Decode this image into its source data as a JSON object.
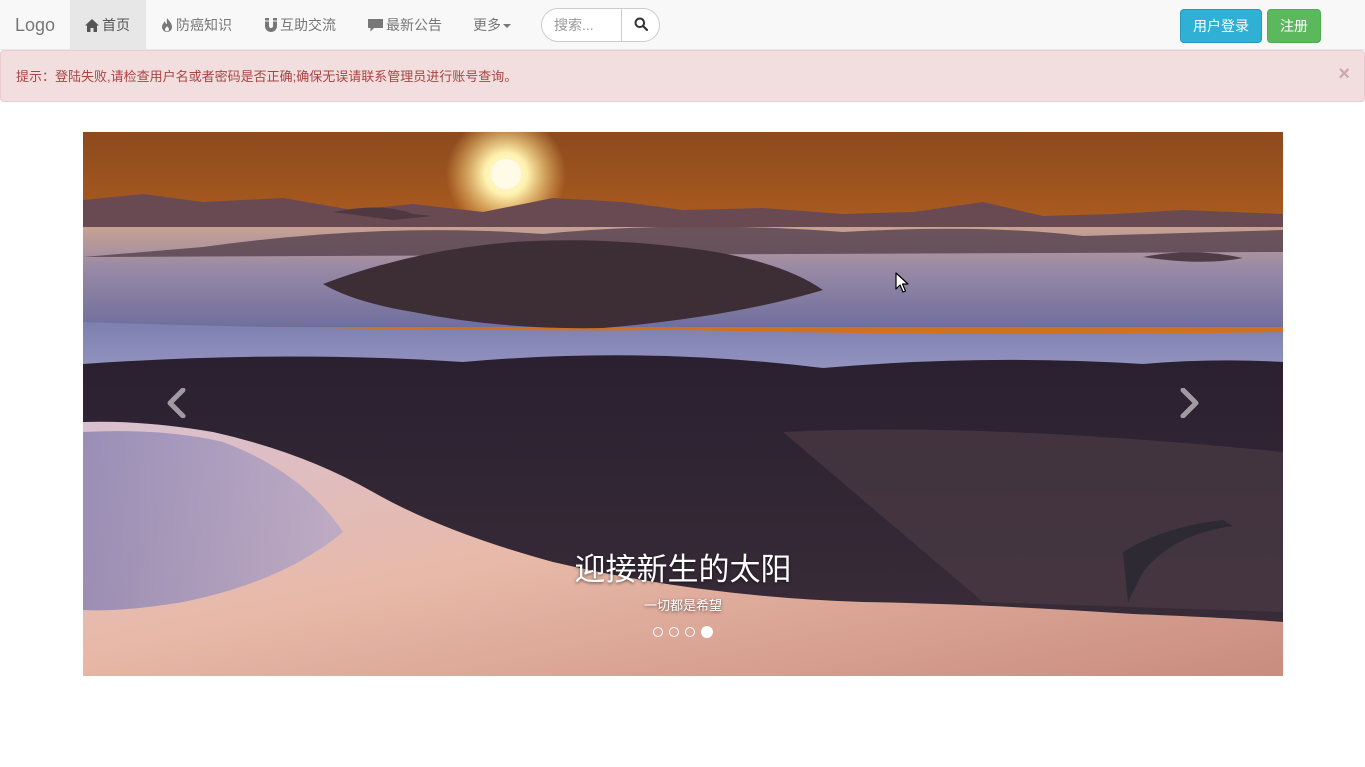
{
  "navbar": {
    "brand": "Logo",
    "items": [
      {
        "label": "首页",
        "icon": "home-icon"
      },
      {
        "label": "防癌知识",
        "icon": "fire-icon"
      },
      {
        "label": "互助交流",
        "icon": "magnet-icon"
      },
      {
        "label": "最新公告",
        "icon": "comment-icon"
      },
      {
        "label": "更多",
        "icon": "caret-down-icon"
      }
    ],
    "search": {
      "placeholder": "搜索..."
    },
    "login_label": "用户登录",
    "register_label": "注册"
  },
  "alert": {
    "text": "提示：登陆失败,请检查用户名或者密码是否正确;确保无误请联系管理员进行账号查询。",
    "close": "×"
  },
  "carousel": {
    "caption_title": "迎接新生的太阳",
    "caption_subtitle": "一切都是希望",
    "slide_count": 4,
    "active_index": 3
  },
  "colors": {
    "login_button": "#31b0d5",
    "register_button": "#5cb85c",
    "alert_bg": "#f2dede",
    "alert_text": "#a94442"
  }
}
